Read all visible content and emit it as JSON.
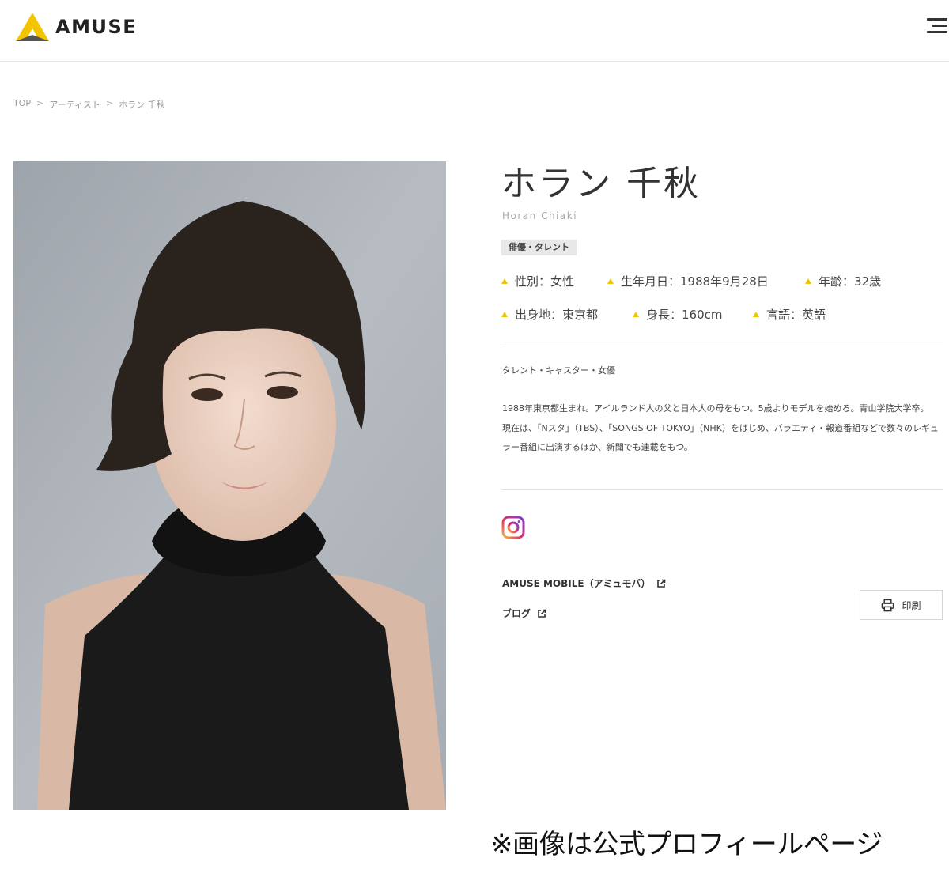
{
  "header": {
    "logo_text": "AMUSE",
    "brand_color": "#f3c400"
  },
  "breadcrumb": {
    "items": [
      "TOP",
      "アーティスト",
      "ホラン 千秋"
    ],
    "separator": ">"
  },
  "profile": {
    "name": "ホラン 千秋",
    "name_en": "Horan Chiaki",
    "category": "俳優・タレント",
    "facts": [
      [
        "性別：女性",
        "生年月日：1988年9月28日",
        "年齢：32歳"
      ],
      [
        "出身地：東京都",
        "身長：160cm",
        "言語：英語"
      ]
    ],
    "occupation": "タレント・キャスター・女優",
    "bio": [
      "1988年東京都生まれ。アイルランド人の父と日本人の母をもつ。5歳よりモデルを始める。青山学院大学卒。",
      "現在は、「Nスタ」（TBS）、「SONGS OF TOKYO」（NHK）をはじめ、バラエティ・報道番組などで数々のレギュラー番組に出演するほか、新聞でも連載をもつ。"
    ]
  },
  "links": {
    "mobile": "AMUSE MOBILE（アミュモバ）",
    "blog": "ブログ",
    "print": "印刷"
  },
  "icons": {
    "logo": "amuse-logo-icon",
    "menu": "hamburger-menu-icon",
    "instagram": "instagram-icon",
    "external": "external-link-icon",
    "print": "printer-icon",
    "bullet": "triangle-bullet-icon"
  },
  "caption": "※画像は公式プロフィールページ"
}
